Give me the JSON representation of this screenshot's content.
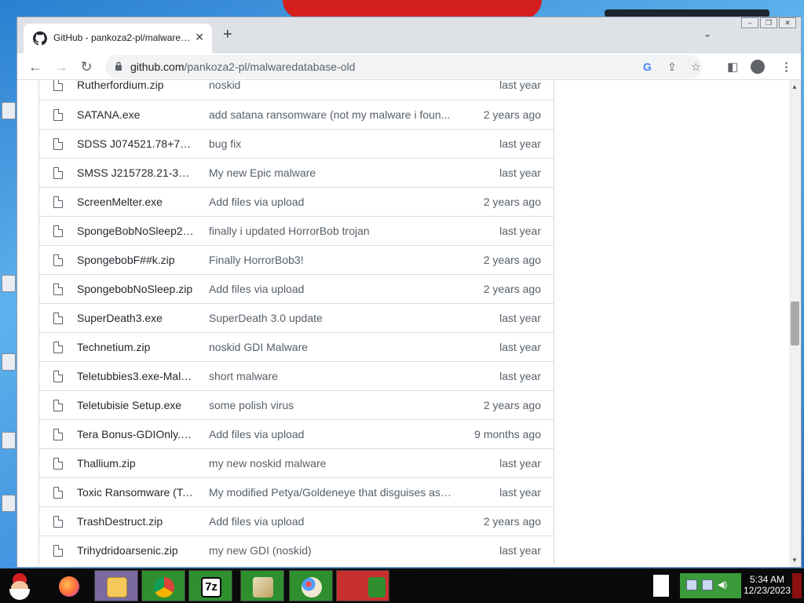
{
  "browser": {
    "tab": {
      "title": "GitHub - pankoza2-pl/malwaredatabase-old",
      "close_icon": "close-icon"
    },
    "new_tab_label": "+",
    "tab_list_icon": "chevron-down-icon",
    "address": {
      "host": "github.com",
      "path": "/pankoza2-pl/malwaredatabase-old"
    },
    "nav": {
      "back": "←",
      "forward": "→",
      "reload": "↻"
    },
    "toolbar_icons": [
      "google-lens-icon",
      "share-icon",
      "bookmark-star-icon",
      "side-panel-icon",
      "profile-icon",
      "more-menu-icon"
    ]
  },
  "files": [
    {
      "name": "Rutherfordium.zip",
      "message": "noskid",
      "age": "last year"
    },
    {
      "name": "SATANA.exe",
      "message": "add satana ransomware (not my malware i foun...",
      "age": "2 years ago"
    },
    {
      "name": "SDSS J074521.78+734...",
      "message": "bug fix",
      "age": "last year"
    },
    {
      "name": "SMSS J215728.21-360...",
      "message": "My new Epic malware",
      "age": "last year"
    },
    {
      "name": "ScreenMelter.exe",
      "message": "Add files via upload",
      "age": "2 years ago"
    },
    {
      "name": "SpongeBobNoSleep2 (...",
      "message": "finally i updated HorrorBob trojan",
      "age": "last year"
    },
    {
      "name": "SpongebobF##k.zip",
      "message": "Finally HorrorBob3!",
      "age": "2 years ago"
    },
    {
      "name": "SpongebobNoSleep.zip",
      "message": "Add files via upload",
      "age": "2 years ago"
    },
    {
      "name": "SuperDeath3.exe",
      "message": "SuperDeath 3.0 update",
      "age": "last year"
    },
    {
      "name": "Technetium.zip",
      "message": "noskid GDI Malware",
      "age": "last year"
    },
    {
      "name": "Teletubbies3.exe-Malw...",
      "message": "short malware",
      "age": "last year"
    },
    {
      "name": "Teletubisie Setup.exe",
      "message": "some polish virus",
      "age": "2 years ago"
    },
    {
      "name": "Tera Bonus-GDIOnly.exe",
      "message": "Add files via upload",
      "age": "9 months ago"
    },
    {
      "name": "Thallium.zip",
      "message": "my new noskid malware",
      "age": "last year"
    },
    {
      "name": "Toxic Ransomware (Tox...",
      "message": "My modified Petya/Goldeneye that disguises as ...",
      "age": "last year"
    },
    {
      "name": "TrashDestruct.zip",
      "message": "Add files via upload",
      "age": "2 years ago"
    },
    {
      "name": "Trihydridoarsenic.zip",
      "message": "my new GDI (noskid)",
      "age": "last year"
    }
  ],
  "taskbar": {
    "apps": [
      "firefox-icon",
      "file-explorer-icon",
      "chrome-icon",
      "7zip-icon",
      "paint-tool-icon",
      "paint-icon",
      "blank-app-icon"
    ],
    "seven_zip_label": "7z",
    "clock": {
      "time": "5:34 AM",
      "date": "12/23/2023"
    }
  }
}
